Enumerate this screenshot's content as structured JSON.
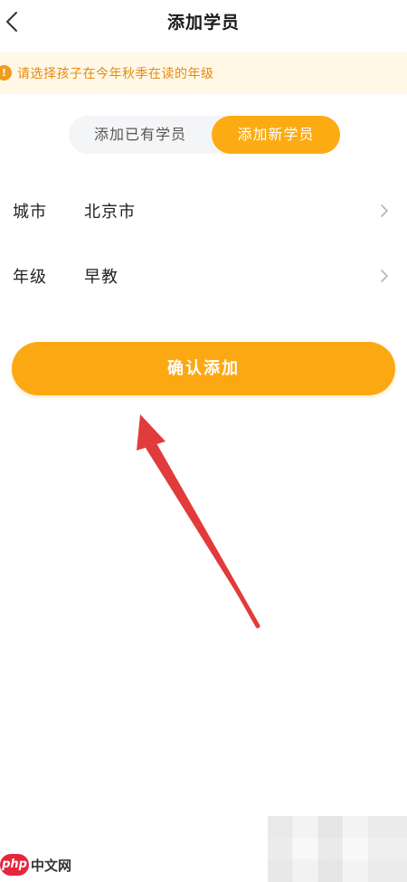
{
  "header": {
    "title": "添加学员",
    "back_icon": "chevron-left-icon"
  },
  "notice": {
    "icon": "exclamation-icon",
    "icon_glyph": "!",
    "text": "请选择孩子在今年秋季在读的年级"
  },
  "segment": {
    "existing_label": "添加已有学员",
    "new_label": "添加新学员",
    "selected": "添加新学员"
  },
  "form": {
    "city": {
      "label": "城市",
      "value": "北京市"
    },
    "grade": {
      "label": "年级",
      "value": "早教"
    }
  },
  "confirm_label": "确认添加",
  "watermark": {
    "logo_text": "php",
    "site_text": "中文网"
  },
  "colors": {
    "accent": "#fca812",
    "notice_bg": "#fff8e6",
    "notice_text": "#e48a14",
    "arrow": "#e23b3b"
  }
}
